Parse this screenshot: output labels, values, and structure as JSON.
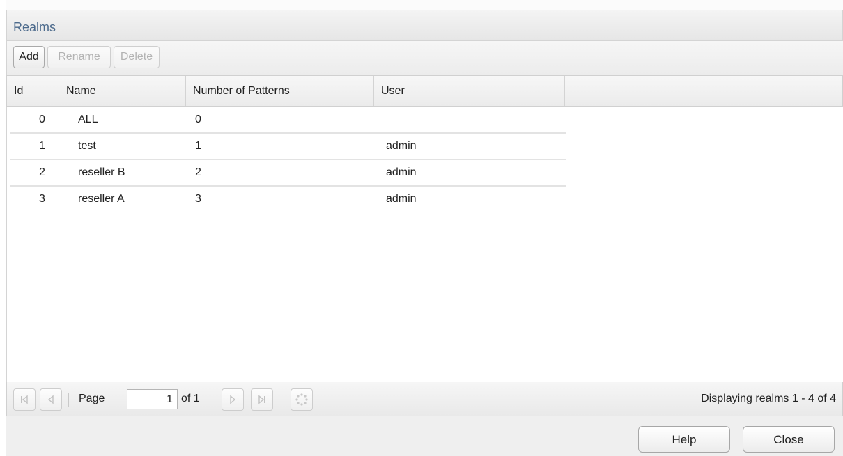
{
  "panel": {
    "title": "Realms"
  },
  "toolbar": {
    "add_label": "Add",
    "rename_label": "Rename",
    "delete_label": "Delete"
  },
  "grid": {
    "columns": [
      "Id",
      "Name",
      "Number of Patterns",
      "User"
    ],
    "rows": [
      {
        "id": "0",
        "name": "ALL",
        "patterns": "0",
        "user": ""
      },
      {
        "id": "1",
        "name": "test",
        "patterns": "1",
        "user": "admin"
      },
      {
        "id": "2",
        "name": "reseller B",
        "patterns": "2",
        "user": "admin"
      },
      {
        "id": "3",
        "name": "reseller A",
        "patterns": "3",
        "user": "admin"
      }
    ]
  },
  "pager": {
    "page_label": "Page",
    "page_value": "1",
    "of_label": "of 1",
    "status": "Displaying realms 1 - 4 of 4",
    "icons": [
      "first-page-icon",
      "prev-page-icon",
      "next-page-icon",
      "last-page-icon",
      "refresh-icon"
    ]
  },
  "footer": {
    "help_label": "Help",
    "close_label": "Close"
  },
  "colors": {
    "title": "#4c6a8c",
    "border": "#d4d4d4",
    "footer_bg": "#efefef"
  }
}
